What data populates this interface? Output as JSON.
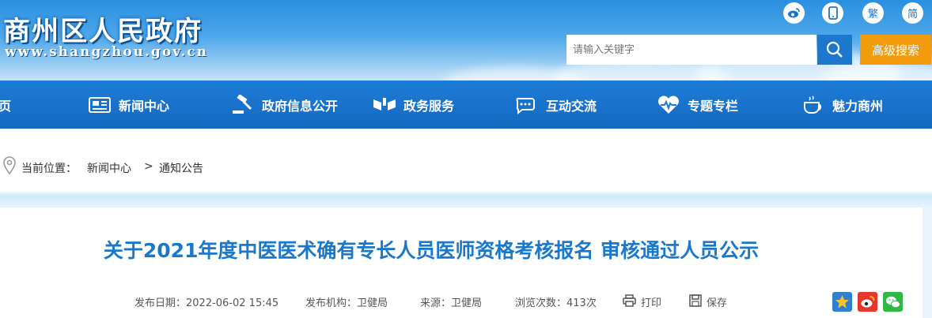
{
  "header": {
    "site_name": "商州区人民政府",
    "site_url": "www.shangzhou.gov.cn",
    "traditional_label": "繁",
    "simplified_label": "简"
  },
  "search": {
    "placeholder": "请输入关键字",
    "advanced_label": "高级搜索"
  },
  "nav": {
    "items": [
      {
        "label": "页",
        "icon": "home-icon"
      },
      {
        "label": "新闻中心",
        "icon": "newspaper-icon"
      },
      {
        "label": "政府信息公开",
        "icon": "gavel-icon"
      },
      {
        "label": "政务服务",
        "icon": "service-icon"
      },
      {
        "label": "互动交流",
        "icon": "chat-icon"
      },
      {
        "label": "专题专栏",
        "icon": "heart-pulse-icon"
      },
      {
        "label": "魅力商州",
        "icon": "teacup-icon"
      }
    ]
  },
  "breadcrumb": {
    "prefix": "当前位置：",
    "level1": "新闻中心",
    "separator": ">",
    "level2": "通知公告"
  },
  "article": {
    "title": "关于2021年度中医医术确有专长人员医师资格考核报名 审核通过人员公示",
    "date": "发布日期：2022-06-02 15:45",
    "publisher": "发布机构：卫健局",
    "source": "来源：卫健局",
    "views": "浏览次数：413次",
    "print_label": "打印",
    "save_label": "保存"
  },
  "colors": {
    "accent_blue": "#1a78cc",
    "nav_blue": "#1d7cd6",
    "search_orange": "#f29c0c"
  }
}
